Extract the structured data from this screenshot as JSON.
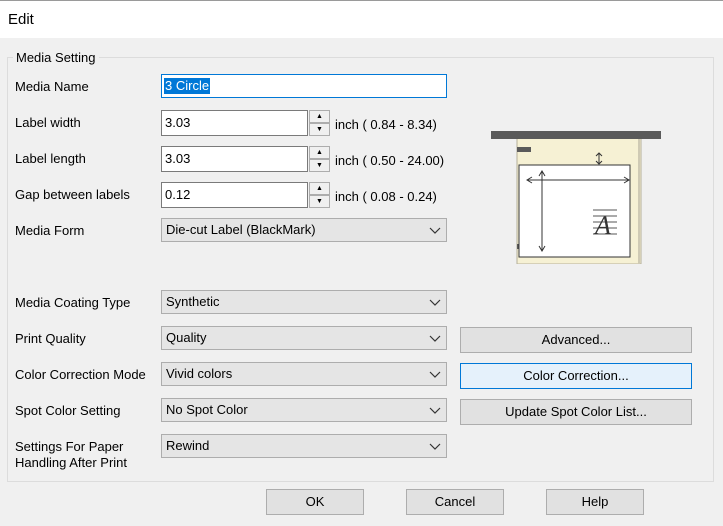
{
  "window": {
    "title": "Edit"
  },
  "group": {
    "label": "Media Setting"
  },
  "fields": {
    "media_name": {
      "label": "Media Name",
      "value": "3 Circle"
    },
    "label_width": {
      "label": "Label width",
      "value": "3.03",
      "range": "inch ( 0.84 -  8.34)"
    },
    "label_length": {
      "label": "Label length",
      "value": "3.03",
      "range": "inch ( 0.50 - 24.00)"
    },
    "gap": {
      "label": "Gap between labels",
      "value": "0.12",
      "range": "inch ( 0.08 -  0.24)"
    },
    "media_form": {
      "label": "Media Form",
      "value": "Die-cut Label (BlackMark)"
    },
    "coating": {
      "label": "Media Coating Type",
      "value": "Synthetic"
    },
    "print_quality": {
      "label": "Print Quality",
      "value": "Quality"
    },
    "color_mode": {
      "label": "Color Correction Mode",
      "value": "Vivid colors"
    },
    "spot_color": {
      "label": "Spot Color Setting",
      "value": "No Spot Color"
    },
    "handling": {
      "label_line1": "Settings For Paper",
      "label_line2": "Handling After Print",
      "value": "Rewind"
    }
  },
  "side_buttons": {
    "advanced": "Advanced...",
    "color_correction": "Color Correction...",
    "update_spot": "Update Spot Color List..."
  },
  "footer": {
    "ok": "OK",
    "cancel": "Cancel",
    "help": "Help"
  },
  "preview": {
    "glyph": "A"
  },
  "colors": {
    "selection": "#0078d7",
    "label_fill": "#f6f1d4",
    "bar": "#5a5a5a"
  }
}
